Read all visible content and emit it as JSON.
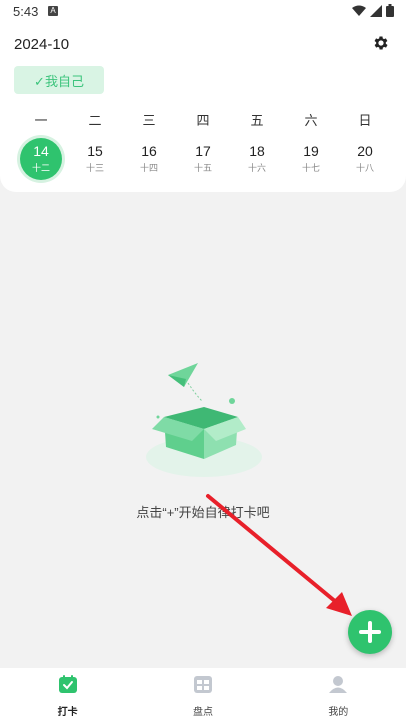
{
  "status": {
    "time": "5:43",
    "notif": "A"
  },
  "header": {
    "month": "2024-10",
    "member_chip": "✓我自己"
  },
  "week": [
    {
      "wd": "一",
      "date": "14",
      "lunar": "十二",
      "selected": true
    },
    {
      "wd": "二",
      "date": "15",
      "lunar": "十三"
    },
    {
      "wd": "三",
      "date": "16",
      "lunar": "十四"
    },
    {
      "wd": "四",
      "date": "17",
      "lunar": "十五"
    },
    {
      "wd": "五",
      "date": "18",
      "lunar": "十六"
    },
    {
      "wd": "六",
      "date": "19",
      "lunar": "十七"
    },
    {
      "wd": "日",
      "date": "20",
      "lunar": "十八"
    }
  ],
  "empty": {
    "message": "点击“+”开始自律打卡吧"
  },
  "tabs": [
    {
      "label": "打卡",
      "icon": "checkin-icon",
      "active": true
    },
    {
      "label": "盘点",
      "icon": "inventory-icon"
    },
    {
      "label": "我的",
      "icon": "profile-icon"
    }
  ],
  "colors": {
    "accent": "#2fc36e",
    "chip_bg": "#d9f4e4",
    "arrow": "#e8202a"
  }
}
